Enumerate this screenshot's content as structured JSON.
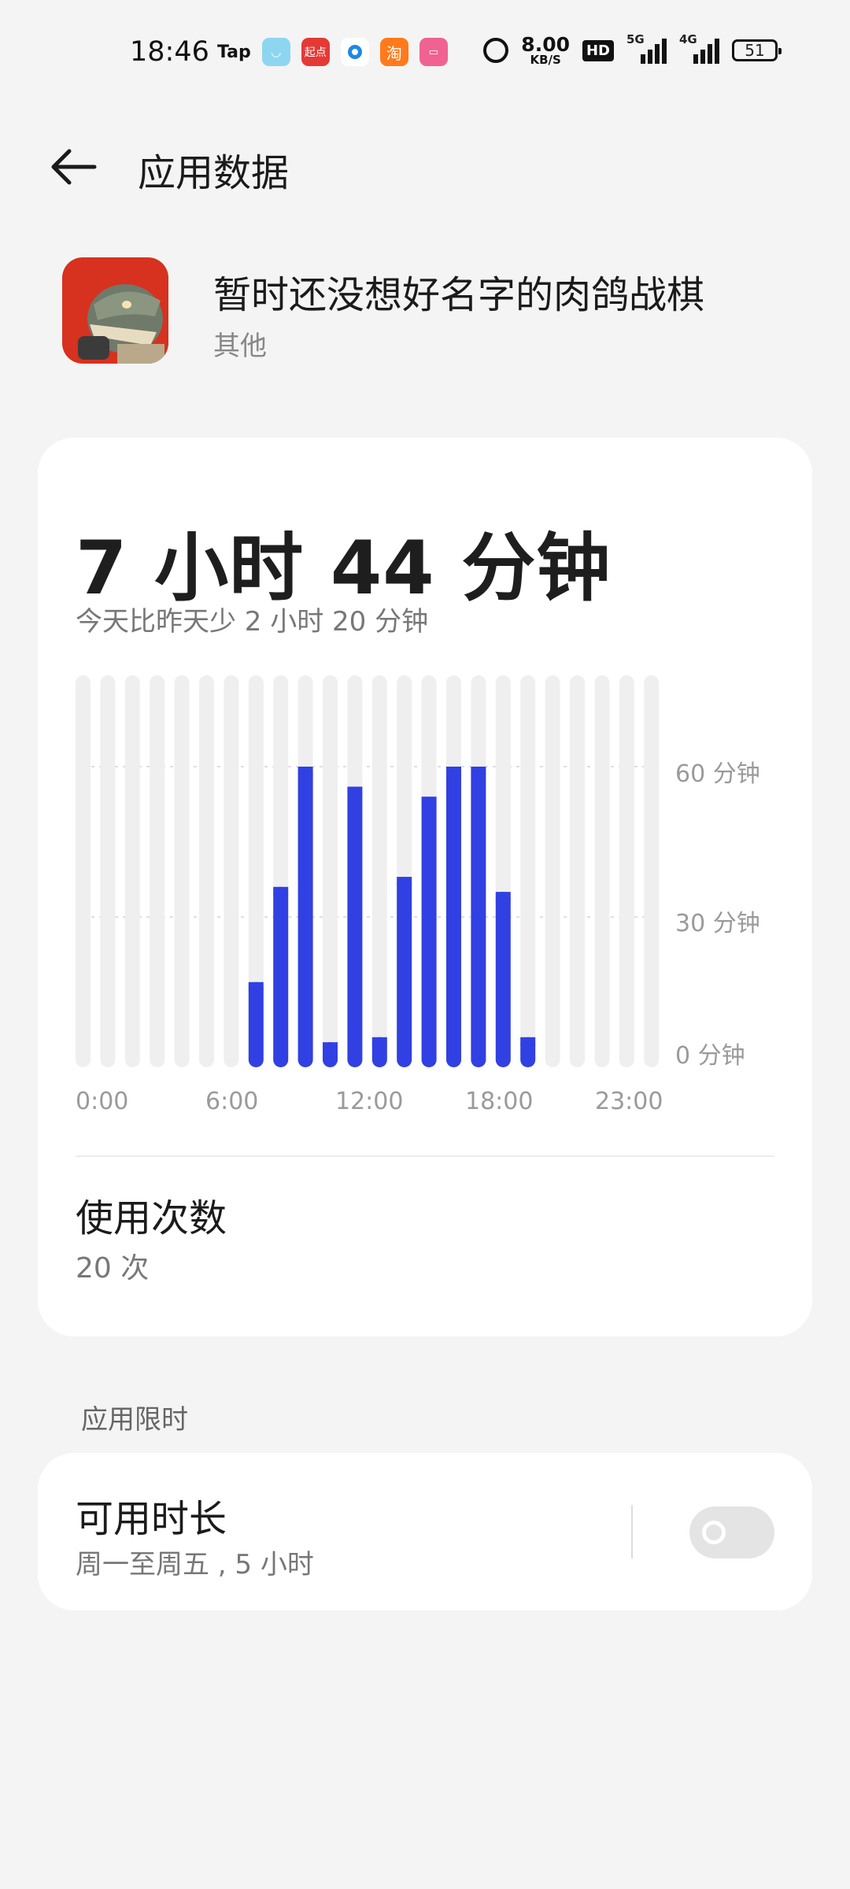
{
  "status_bar": {
    "time": "18:46",
    "tap_label": "Tap",
    "qidian_label": "起点",
    "taobao_label": "淘",
    "net_speed": "8.00",
    "net_unit": "KB/S",
    "hd_label": "HD",
    "sig1_label": "5G",
    "sig2_label": "4G",
    "battery": "51"
  },
  "header": {
    "title": "应用数据",
    "back_icon": "arrow-left-icon"
  },
  "app": {
    "name": "暂时还没想好名字的肉鸽战棋",
    "category": "其他"
  },
  "usage": {
    "total": "7 小时 44 分钟",
    "compare": "今天比昨天少 2 小时 20 分钟"
  },
  "chart_data": {
    "type": "bar",
    "categories": [
      "0",
      "1",
      "2",
      "3",
      "4",
      "5",
      "6",
      "7",
      "8",
      "9",
      "10",
      "11",
      "12",
      "13",
      "14",
      "15",
      "16",
      "17",
      "18",
      "19",
      "20",
      "21",
      "22",
      "23"
    ],
    "values": [
      0,
      0,
      0,
      0,
      0,
      0,
      0,
      17,
      36,
      60,
      5,
      56,
      6,
      38,
      54,
      60,
      60,
      35,
      6,
      0,
      0,
      0,
      0,
      0
    ],
    "ylim": [
      0,
      60
    ],
    "y_tick_labels": [
      "60 分钟",
      "30 分钟",
      "0 分钟"
    ],
    "x_tick_labels": [
      "0:00",
      "6:00",
      "12:00",
      "18:00",
      "23:00"
    ],
    "bar_color": "#3140e2",
    "track_color": "#efefef"
  },
  "launches": {
    "title": "使用次数",
    "value": "20 次"
  },
  "limit_section": {
    "label": "应用限时",
    "item_title": "可用时长",
    "item_sub": "周一至周五 , 5 小时",
    "toggle_on": false
  }
}
